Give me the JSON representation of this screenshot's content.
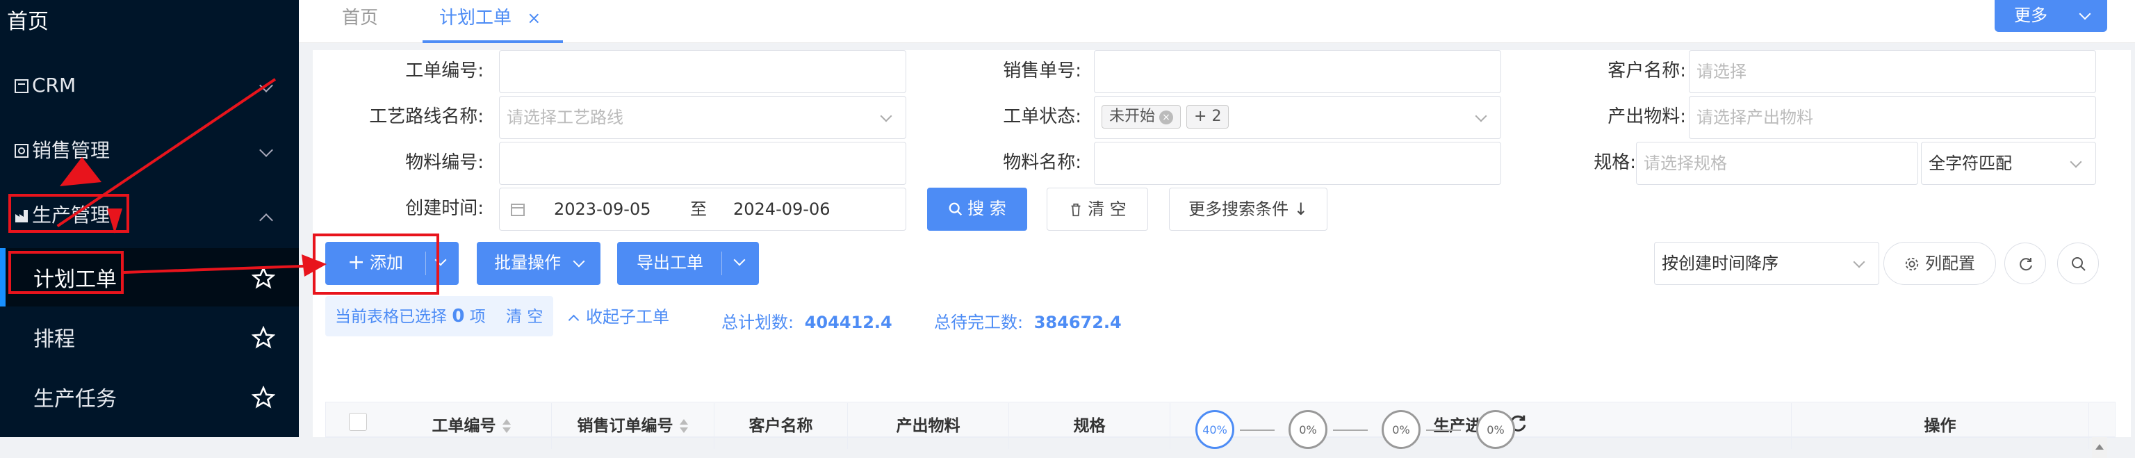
{
  "sidebar": {
    "home": "首页",
    "crm": "CRM",
    "sales": "销售管理",
    "production": "生产管理",
    "sub_items": [
      "计划工单",
      "排程",
      "生产任务"
    ]
  },
  "tabs": {
    "home": "首页",
    "work_order": "计划工单",
    "close": "×",
    "more": "更多"
  },
  "filters": {
    "work_order_no": "工单编号:",
    "sales_no": "销售单号:",
    "customer_name": "客户名称:",
    "customer_placeholder": "请选择",
    "route_name": "工艺路线名称:",
    "route_placeholder": "请选择工艺路线",
    "status": "工单状态:",
    "status_chip": "未开始",
    "status_more": "+ 2",
    "output_material": "产出物料:",
    "output_placeholder": "请选择产出物料",
    "material_no": "物料编号:",
    "material_name": "物料名称:",
    "spec": "规格:",
    "spec_placeholder": "请选择规格",
    "match_mode": "全字符匹配",
    "created_time": "创建时间:",
    "date_from": "2023-09-05",
    "date_sep": "至",
    "date_to": "2024-09-06",
    "search": "搜 索",
    "clear": "清 空",
    "more_conditions": "更多搜索条件 ↓"
  },
  "toolbar": {
    "add": "添加",
    "batch": "批量操作",
    "export": "导出工单",
    "sort": "按创建时间降序",
    "columns": "列配置"
  },
  "summary": {
    "selected_prefix": "当前表格已选择",
    "selected_count": "0",
    "selected_suffix": "项",
    "clear": "清 空",
    "collapse": "收起子工单",
    "total_plan_label": "总计划数:",
    "total_plan": "404412.4",
    "total_pending_label": "总待完工数:",
    "total_pending": "384672.4"
  },
  "table": {
    "headers": [
      "工单编号",
      "销售订单编号",
      "客户名称",
      "产出物料",
      "规格",
      "生产进度",
      "操作"
    ],
    "progress": [
      "40%",
      "0%",
      "0%",
      "0%"
    ]
  },
  "colors": {
    "primary": "#4d8cf5",
    "sidebar": "#001529",
    "annotation": "#e8141c"
  }
}
